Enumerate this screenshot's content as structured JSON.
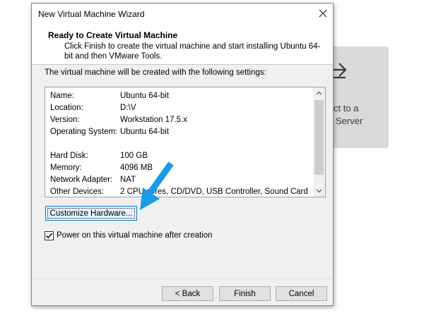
{
  "background": {
    "tile_text_line1": "ct to a",
    "tile_text_line2": "Server",
    "icon": "arrow-right-icon"
  },
  "dialog": {
    "title": "New Virtual Machine Wizard",
    "header_title": "Ready to Create Virtual Machine",
    "header_desc": "Click Finish to create the virtual machine and start installing Ubuntu 64-bit and then VMware Tools.",
    "intro": "The virtual machine will be created with the following settings:",
    "settings": [
      {
        "key": "Name:",
        "value": "Ubuntu 64-bit"
      },
      {
        "key": "Location:",
        "value": "D:\\V"
      },
      {
        "key": "Version:",
        "value": "Workstation 17.5.x"
      },
      {
        "key": "Operating System:",
        "value": "Ubuntu 64-bit"
      },
      {
        "key": "",
        "value": ""
      },
      {
        "key": "Hard Disk:",
        "value": "100 GB"
      },
      {
        "key": "Memory:",
        "value": "4096 MB"
      },
      {
        "key": "Network Adapter:",
        "value": "NAT"
      },
      {
        "key": "Other Devices:",
        "value": "2 CPU cores, CD/DVD, USB Controller, Sound Card"
      }
    ],
    "customize_label": "Customize Hardware...",
    "power_on_label": "Power on this virtual machine after creation",
    "power_on_checked": true,
    "back_label": "< Back",
    "finish_label": "Finish",
    "cancel_label": "Cancel"
  },
  "colors": {
    "callout_arrow": "#1a9be6",
    "focus_border": "#0078d7"
  }
}
